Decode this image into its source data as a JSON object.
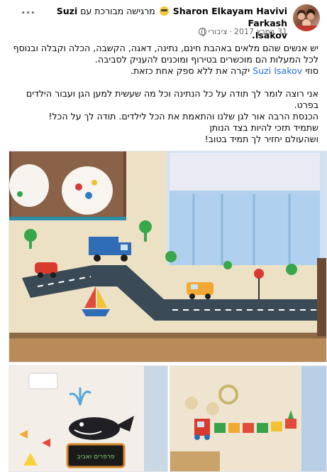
{
  "post": {
    "author": "Sharon Elkayam Havivi",
    "feeling": "מרגישה מבורכת עם",
    "tagged": "Suzi Farkash",
    "tagged_line2": "Isakov",
    "date": "31 במרץ 2017",
    "separator": "·",
    "privacy": "ציבורי",
    "menu": "···"
  },
  "body": {
    "para1": "יש אנשים שהם מלאים באהבת חינם, נתינה, דאגה, הקשבה, הכלה וקבלה ובנוסף לכל המעלות הם מוכשרים בטירוף ומוכנים להעניק לסביבה.",
    "para2_prefix": "סוזי",
    "mention": "Suzi Isakov",
    "para2_suffix": "יקרה את ללא ספק אחת כזאת.",
    "para3": "אני רוצה לומר לך תודה על כל הנתינה וכל מה שעשית למען הגן ועבור הילדים בפרט.",
    "para4": "הכנסת הרבה אור לגן שלנו והתאמת את הכל לילדים. תודה לך על הכל!",
    "para5": "שתמיד תזכי להיות בצד הנותן",
    "para6": "ושהעולם יחזיר לך תמיד בטוב!"
  },
  "photos": {
    "bottom_left_sign": "פרפרים ואביב"
  },
  "colors": {
    "text": "#050505",
    "secondary": "#65676b",
    "link": "#216fdb",
    "wall": "#efe6cf",
    "road": "#3a4a56"
  },
  "icons": {
    "menu": "more-options-icon",
    "privacy": "globe-icon",
    "feeling": "smiling-face-icon"
  }
}
